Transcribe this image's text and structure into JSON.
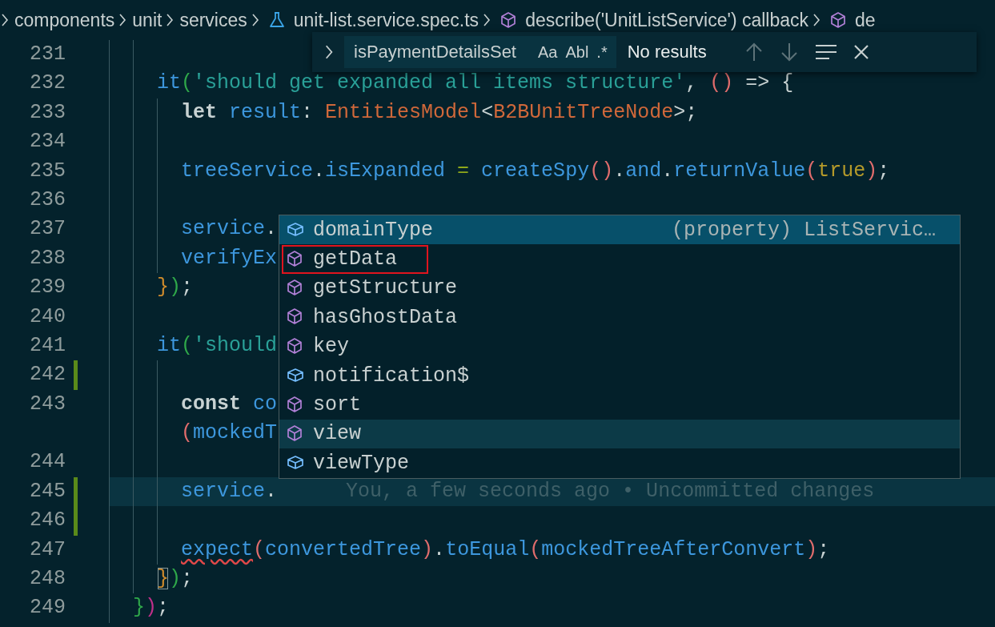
{
  "breadcrumbs": [
    {
      "label": "components"
    },
    {
      "label": "unit"
    },
    {
      "label": "services"
    },
    {
      "label": "unit-list.service.spec.ts",
      "kind": "test-file"
    },
    {
      "label": "describe('UnitListService') callback",
      "kind": "symbol"
    },
    {
      "label": "de",
      "kind": "symbol"
    }
  ],
  "editor": {
    "lines": [
      {
        "number": "231"
      },
      {
        "number": "232",
        "tokens": [
          {
            "text": "    it",
            "kind": "function"
          },
          {
            "text": "(",
            "kind": "bracket2"
          },
          {
            "text": "'should get expanded all items structure'",
            "kind": "string"
          },
          {
            "text": ", ",
            "kind": "punct"
          },
          {
            "text": "()",
            "kind": "bracket3"
          },
          {
            "text": " => {",
            "kind": "punct"
          }
        ]
      },
      {
        "number": "233",
        "tokens": [
          {
            "text": "      let",
            "kind": "keyword"
          },
          {
            "text": " result",
            "kind": "variable"
          },
          {
            "text": ": ",
            "kind": "punct"
          },
          {
            "text": "EntitiesModel",
            "kind": "type"
          },
          {
            "text": "<",
            "kind": "punct"
          },
          {
            "text": "B2BUnitTreeNode",
            "kind": "type"
          },
          {
            "text": ">;",
            "kind": "punct"
          }
        ]
      },
      {
        "number": "234"
      },
      {
        "number": "235",
        "tokens": [
          {
            "text": "      treeService",
            "kind": "variable"
          },
          {
            "text": ".",
            "kind": "punct"
          },
          {
            "text": "isExpanded",
            "kind": "variable"
          },
          {
            "text": " = ",
            "kind": "operator"
          },
          {
            "text": "createSpy",
            "kind": "function"
          },
          {
            "text": "()",
            "kind": "bracket3"
          },
          {
            "text": ".",
            "kind": "punct"
          },
          {
            "text": "and",
            "kind": "variable"
          },
          {
            "text": ".",
            "kind": "punct"
          },
          {
            "text": "returnValue",
            "kind": "function"
          },
          {
            "text": "(",
            "kind": "bracket3"
          },
          {
            "text": "true",
            "kind": "boolean"
          },
          {
            "text": ")",
            "kind": "bracket3"
          },
          {
            "text": ";",
            "kind": "punct"
          }
        ]
      },
      {
        "number": "236"
      },
      {
        "number": "237",
        "tokens": [
          {
            "text": "      service",
            "kind": "variable"
          },
          {
            "text": ".",
            "kind": "punct"
          }
        ]
      },
      {
        "number": "238",
        "tokens": [
          {
            "text": "      verifyEx",
            "kind": "function"
          }
        ]
      },
      {
        "number": "239",
        "tokens": [
          {
            "text": "    }",
            "kind": "bracket1"
          },
          {
            "text": ")",
            "kind": "bracket2"
          },
          {
            "text": ";",
            "kind": "punct"
          }
        ]
      },
      {
        "number": "240"
      },
      {
        "number": "241",
        "tokens": [
          {
            "text": "    it",
            "kind": "function"
          },
          {
            "text": "(",
            "kind": "bracket2"
          },
          {
            "text": "'should",
            "kind": "string"
          }
        ]
      },
      {
        "number": "242",
        "changed": true
      },
      {
        "number": "243",
        "tokens": [
          {
            "text": "      const",
            "kind": "keyword"
          },
          {
            "text": " co",
            "kind": "variable"
          }
        ]
      },
      {
        "tokens": [
          {
            "text": "      (",
            "kind": "bracket3"
          },
          {
            "text": "mockedT",
            "kind": "variable"
          }
        ]
      },
      {
        "number": "244"
      },
      {
        "number": "245",
        "tokens": [
          {
            "text": "      service",
            "kind": "variable"
          },
          {
            "text": ".",
            "kind": "punct"
          }
        ],
        "changed": true,
        "current": true,
        "blame": "You, a few seconds ago • Uncommitted changes"
      },
      {
        "number": "246",
        "changed": true
      },
      {
        "number": "247",
        "tokens": [
          {
            "text": "      expect",
            "kind": "function",
            "error": true
          },
          {
            "text": "(",
            "kind": "bracket3"
          },
          {
            "text": "convertedTree",
            "kind": "variable"
          },
          {
            "text": ")",
            "kind": "bracket3"
          },
          {
            "text": ".",
            "kind": "punct"
          },
          {
            "text": "toEqual",
            "kind": "function"
          },
          {
            "text": "(",
            "kind": "bracket3"
          },
          {
            "text": "mockedTreeAfterConvert",
            "kind": "variable"
          },
          {
            "text": ")",
            "kind": "bracket3"
          },
          {
            "text": ";",
            "kind": "punct"
          }
        ]
      },
      {
        "number": "248",
        "tokens": [
          {
            "text": "    }",
            "kind": "bracket1",
            "matched": true
          },
          {
            "text": ")",
            "kind": "bracket2"
          },
          {
            "text": ";",
            "kind": "punct"
          }
        ]
      },
      {
        "number": "249",
        "tokens": [
          {
            "text": "  }",
            "kind": "bracket2"
          },
          {
            "text": ")",
            "kind": "bracket4"
          },
          {
            "text": ";",
            "kind": "punct"
          }
        ]
      }
    ]
  },
  "find_widget": {
    "query": "isPaymentDetailsSet",
    "options": [
      {
        "label": "Aa",
        "on": false
      },
      {
        "label": "Abl",
        "on": false
      },
      {
        "label": ".*",
        "on": false
      }
    ],
    "result": "No results"
  },
  "suggestions": [
    {
      "label": "domainType",
      "kind": "field",
      "selected": true,
      "detail": "(property) ListServic…"
    },
    {
      "label": "getData",
      "kind": "method",
      "selected": false,
      "highlighted": true
    },
    {
      "label": "getStructure",
      "kind": "method",
      "selected": false
    },
    {
      "label": "hasGhostData",
      "kind": "method",
      "selected": false
    },
    {
      "label": "key",
      "kind": "method",
      "selected": false
    },
    {
      "label": "notification$",
      "kind": "field",
      "selected": false
    },
    {
      "label": "sort",
      "kind": "method",
      "selected": false
    },
    {
      "label": "view",
      "kind": "method",
      "selected": false,
      "hovered": true
    },
    {
      "label": "viewType",
      "kind": "field",
      "selected": false
    }
  ]
}
